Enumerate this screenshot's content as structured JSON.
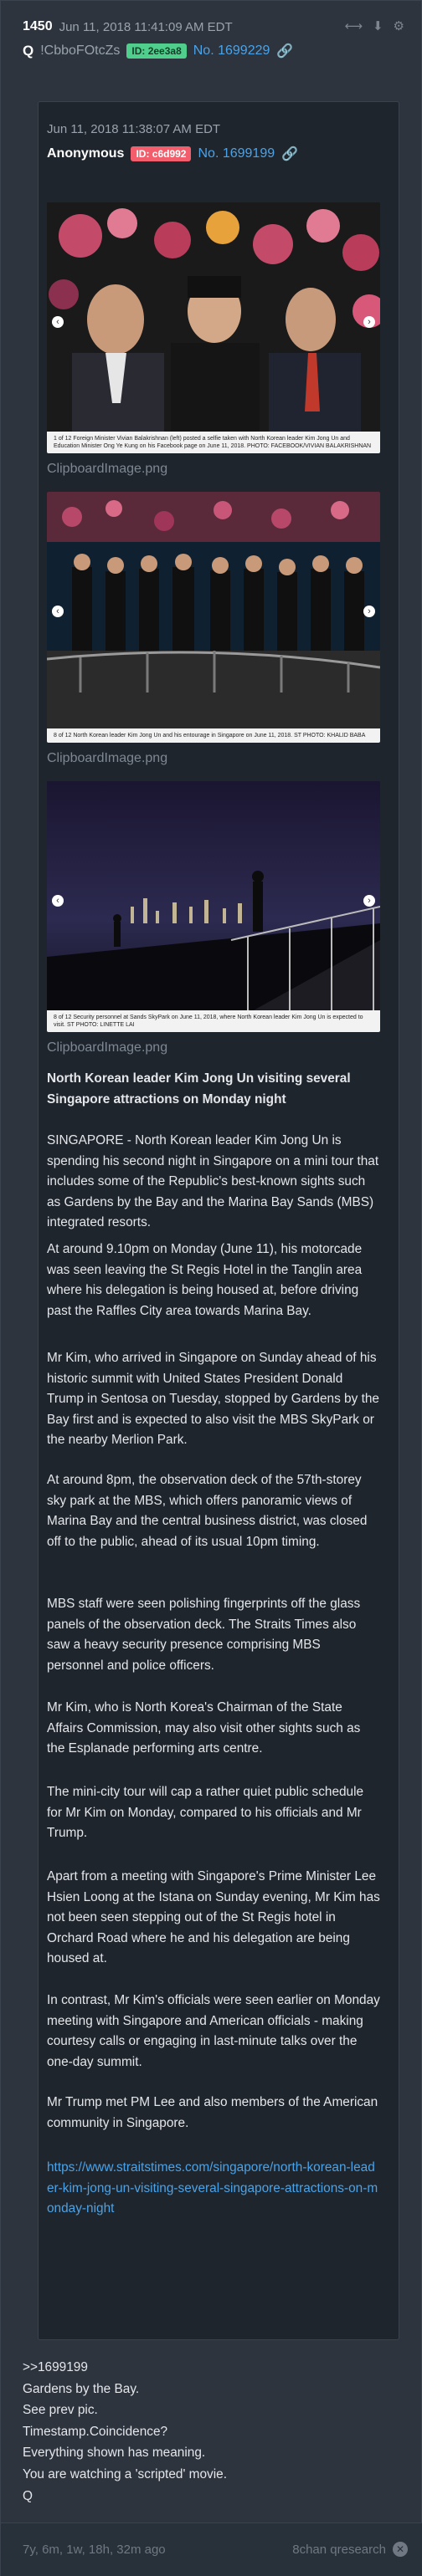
{
  "post": {
    "number": "1450",
    "date": "Jun 11, 2018 11:41:09 AM EDT",
    "author": "Q",
    "tripcode": "!CbboFOtcZs",
    "id_badge": "ID: 2ee3a8",
    "post_link": "No. 1699229",
    "icons": [
      "share-icon",
      "download-icon",
      "settings-icon"
    ]
  },
  "quoted": {
    "date": "Jun 11, 2018 11:38:07 AM EDT",
    "author": "Anonymous",
    "id_badge": "ID: c6d992",
    "post_link": "No. 1699199",
    "images": [
      {
        "filename": "ClipboardImage.png",
        "caption": "1 of 12  Foreign Minister Vivian Balakrishnan (left) posted a selfie taken with North Korean leader Kim Jong Un and Education Minister Ong Ye Kung on his Facebook page on June 11, 2018. PHOTO: FACEBOOK/VIVIAN BALAKRISHNAN"
      },
      {
        "filename": "ClipboardImage.png",
        "caption": "8 of 12  North Korean leader Kim Jong Un and his entourage in Singapore on June 11, 2018. ST PHOTO: KHALID BABA"
      },
      {
        "filename": "ClipboardImage.png",
        "caption": "8 of 12  Security personnel at Sands SkyPark on June 11, 2018, where North Korean leader Kim Jong Un is expected to visit. ST PHOTO: LINETTE LAI"
      }
    ],
    "article": {
      "title": "North Korean leader Kim Jong Un visiting several Singapore attractions on Monday night",
      "paragraphs": [
        "SINGAPORE - North Korean leader Kim Jong Un is spending his second night in Singapore on a mini tour that includes some of the Republic's best-known sights such as Gardens by the Bay and the Marina Bay Sands (MBS) integrated resorts.",
        "At around 9.10pm on Monday (June 11), his motorcade was seen leaving the St Regis Hotel in the Tanglin area where his delegation is being housed at, before driving past the Raffles City area towards Marina Bay.",
        "Mr Kim, who arrived in Singapore on Sunday ahead of his historic summit with United States President Donald Trump in Sentosa on Tuesday, stopped by Gardens by the Bay first and is expected to also visit the MBS SkyPark or the nearby Merlion Park.",
        "At around 8pm, the observation deck of the 57th-storey sky park at the MBS, which offers panoramic views of Marina Bay and the central business district, was closed off to the public, ahead of its usual 10pm timing.",
        "MBS staff were seen polishing fingerprints off the glass panels of the observation deck. The Straits Times also saw a heavy security presence comprising MBS personnel and police officers.",
        "Mr Kim, who is North Korea's Chairman of the State Affairs Commission, may also visit other sights such as the Esplanade performing arts centre.",
        "The mini-city tour will cap a rather quiet public schedule for Mr Kim on Monday, compared to his officials and Mr Trump.",
        "Apart from a meeting with Singapore's Prime Minister Lee Hsien Loong at the Istana on Sunday evening, Mr Kim has not been seen stepping out of the St Regis hotel in Orchard Road where he and his delegation are being housed at.",
        "In contrast, Mr Kim's officials were seen earlier on Monday meeting with Singapore and American officials - making courtesy calls or engaging in last-minute talks over the one-day summit.",
        "Mr Trump met PM Lee and also members of the American community in Singapore."
      ],
      "url": "https://www.straitstimes.com/singapore/north-korean-leader-kim-jong-un-visiting-several-singapore-attractions-on-monday-night"
    }
  },
  "reply_lines": [
    ">>1699199",
    "Gardens by the Bay.",
    "See prev pic.",
    "Timestamp.Coincidence?",
    "Everything shown has meaning.",
    "You are watching a 'scripted' movie.",
    "Q"
  ],
  "footer": {
    "age": "7y, 6m, 1w, 18h, 32m ago",
    "source": "8chan qresearch"
  }
}
